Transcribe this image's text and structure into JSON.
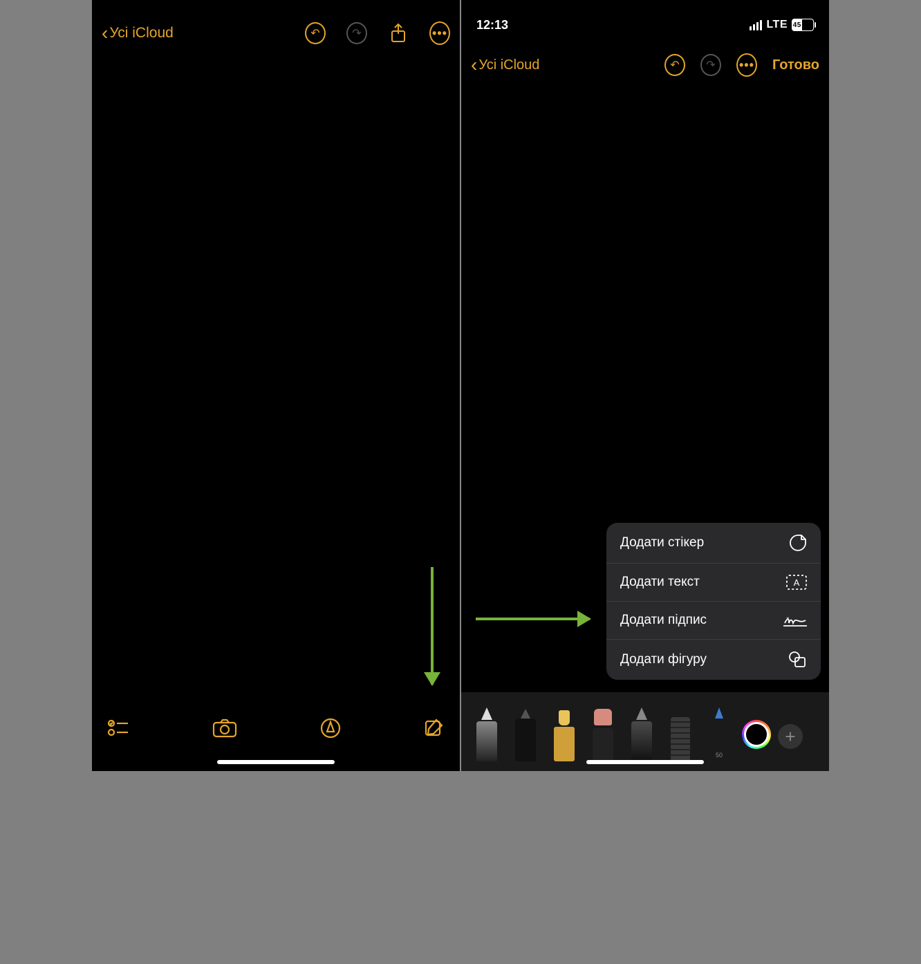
{
  "left": {
    "back_label": "Усі iCloud",
    "toolbar": {
      "undo_icon": "undo",
      "redo_icon": "redo",
      "share_icon": "share",
      "more_icon": "more"
    },
    "bottom": {
      "checklist_icon": "checklist",
      "camera_icon": "camera",
      "markup_icon": "markup",
      "compose_icon": "compose"
    }
  },
  "right": {
    "status": {
      "time": "12:13",
      "network": "LTE",
      "battery_pct": 45
    },
    "back_label": "Усі iCloud",
    "done_label": "Готово",
    "popup": [
      {
        "label": "Додати стікер",
        "icon": "sticker"
      },
      {
        "label": "Додати текст",
        "icon": "textbox"
      },
      {
        "label": "Додати підпис",
        "icon": "signature"
      },
      {
        "label": "Додати фігуру",
        "icon": "shape"
      }
    ],
    "tools": [
      {
        "name": "pen",
        "icon": "pen"
      },
      {
        "name": "marker",
        "icon": "marker"
      },
      {
        "name": "highlighter",
        "icon": "highlighter"
      },
      {
        "name": "eraser",
        "icon": "eraser"
      },
      {
        "name": "pencil",
        "icon": "pencil"
      },
      {
        "name": "ruler",
        "icon": "ruler"
      },
      {
        "name": "blue-pen",
        "icon": "blue-pen",
        "size_label": "50"
      }
    ],
    "color_picker": "color-wheel",
    "add_button": "+"
  }
}
